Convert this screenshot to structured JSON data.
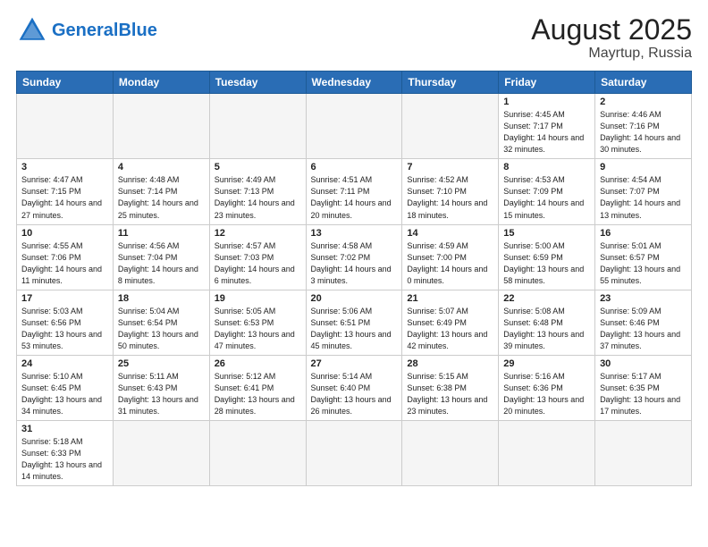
{
  "header": {
    "logo_general": "General",
    "logo_blue": "Blue",
    "month_year": "August 2025",
    "location": "Mayrtup, Russia"
  },
  "weekdays": [
    "Sunday",
    "Monday",
    "Tuesday",
    "Wednesday",
    "Thursday",
    "Friday",
    "Saturday"
  ],
  "weeks": [
    [
      {
        "day": "",
        "info": ""
      },
      {
        "day": "",
        "info": ""
      },
      {
        "day": "",
        "info": ""
      },
      {
        "day": "",
        "info": ""
      },
      {
        "day": "",
        "info": ""
      },
      {
        "day": "1",
        "info": "Sunrise: 4:45 AM\nSunset: 7:17 PM\nDaylight: 14 hours and 32 minutes."
      },
      {
        "day": "2",
        "info": "Sunrise: 4:46 AM\nSunset: 7:16 PM\nDaylight: 14 hours and 30 minutes."
      }
    ],
    [
      {
        "day": "3",
        "info": "Sunrise: 4:47 AM\nSunset: 7:15 PM\nDaylight: 14 hours and 27 minutes."
      },
      {
        "day": "4",
        "info": "Sunrise: 4:48 AM\nSunset: 7:14 PM\nDaylight: 14 hours and 25 minutes."
      },
      {
        "day": "5",
        "info": "Sunrise: 4:49 AM\nSunset: 7:13 PM\nDaylight: 14 hours and 23 minutes."
      },
      {
        "day": "6",
        "info": "Sunrise: 4:51 AM\nSunset: 7:11 PM\nDaylight: 14 hours and 20 minutes."
      },
      {
        "day": "7",
        "info": "Sunrise: 4:52 AM\nSunset: 7:10 PM\nDaylight: 14 hours and 18 minutes."
      },
      {
        "day": "8",
        "info": "Sunrise: 4:53 AM\nSunset: 7:09 PM\nDaylight: 14 hours and 15 minutes."
      },
      {
        "day": "9",
        "info": "Sunrise: 4:54 AM\nSunset: 7:07 PM\nDaylight: 14 hours and 13 minutes."
      }
    ],
    [
      {
        "day": "10",
        "info": "Sunrise: 4:55 AM\nSunset: 7:06 PM\nDaylight: 14 hours and 11 minutes."
      },
      {
        "day": "11",
        "info": "Sunrise: 4:56 AM\nSunset: 7:04 PM\nDaylight: 14 hours and 8 minutes."
      },
      {
        "day": "12",
        "info": "Sunrise: 4:57 AM\nSunset: 7:03 PM\nDaylight: 14 hours and 6 minutes."
      },
      {
        "day": "13",
        "info": "Sunrise: 4:58 AM\nSunset: 7:02 PM\nDaylight: 14 hours and 3 minutes."
      },
      {
        "day": "14",
        "info": "Sunrise: 4:59 AM\nSunset: 7:00 PM\nDaylight: 14 hours and 0 minutes."
      },
      {
        "day": "15",
        "info": "Sunrise: 5:00 AM\nSunset: 6:59 PM\nDaylight: 13 hours and 58 minutes."
      },
      {
        "day": "16",
        "info": "Sunrise: 5:01 AM\nSunset: 6:57 PM\nDaylight: 13 hours and 55 minutes."
      }
    ],
    [
      {
        "day": "17",
        "info": "Sunrise: 5:03 AM\nSunset: 6:56 PM\nDaylight: 13 hours and 53 minutes."
      },
      {
        "day": "18",
        "info": "Sunrise: 5:04 AM\nSunset: 6:54 PM\nDaylight: 13 hours and 50 minutes."
      },
      {
        "day": "19",
        "info": "Sunrise: 5:05 AM\nSunset: 6:53 PM\nDaylight: 13 hours and 47 minutes."
      },
      {
        "day": "20",
        "info": "Sunrise: 5:06 AM\nSunset: 6:51 PM\nDaylight: 13 hours and 45 minutes."
      },
      {
        "day": "21",
        "info": "Sunrise: 5:07 AM\nSunset: 6:49 PM\nDaylight: 13 hours and 42 minutes."
      },
      {
        "day": "22",
        "info": "Sunrise: 5:08 AM\nSunset: 6:48 PM\nDaylight: 13 hours and 39 minutes."
      },
      {
        "day": "23",
        "info": "Sunrise: 5:09 AM\nSunset: 6:46 PM\nDaylight: 13 hours and 37 minutes."
      }
    ],
    [
      {
        "day": "24",
        "info": "Sunrise: 5:10 AM\nSunset: 6:45 PM\nDaylight: 13 hours and 34 minutes."
      },
      {
        "day": "25",
        "info": "Sunrise: 5:11 AM\nSunset: 6:43 PM\nDaylight: 13 hours and 31 minutes."
      },
      {
        "day": "26",
        "info": "Sunrise: 5:12 AM\nSunset: 6:41 PM\nDaylight: 13 hours and 28 minutes."
      },
      {
        "day": "27",
        "info": "Sunrise: 5:14 AM\nSunset: 6:40 PM\nDaylight: 13 hours and 26 minutes."
      },
      {
        "day": "28",
        "info": "Sunrise: 5:15 AM\nSunset: 6:38 PM\nDaylight: 13 hours and 23 minutes."
      },
      {
        "day": "29",
        "info": "Sunrise: 5:16 AM\nSunset: 6:36 PM\nDaylight: 13 hours and 20 minutes."
      },
      {
        "day": "30",
        "info": "Sunrise: 5:17 AM\nSunset: 6:35 PM\nDaylight: 13 hours and 17 minutes."
      }
    ],
    [
      {
        "day": "31",
        "info": "Sunrise: 5:18 AM\nSunset: 6:33 PM\nDaylight: 13 hours and 14 minutes."
      },
      {
        "day": "",
        "info": ""
      },
      {
        "day": "",
        "info": ""
      },
      {
        "day": "",
        "info": ""
      },
      {
        "day": "",
        "info": ""
      },
      {
        "day": "",
        "info": ""
      },
      {
        "day": "",
        "info": ""
      }
    ]
  ]
}
